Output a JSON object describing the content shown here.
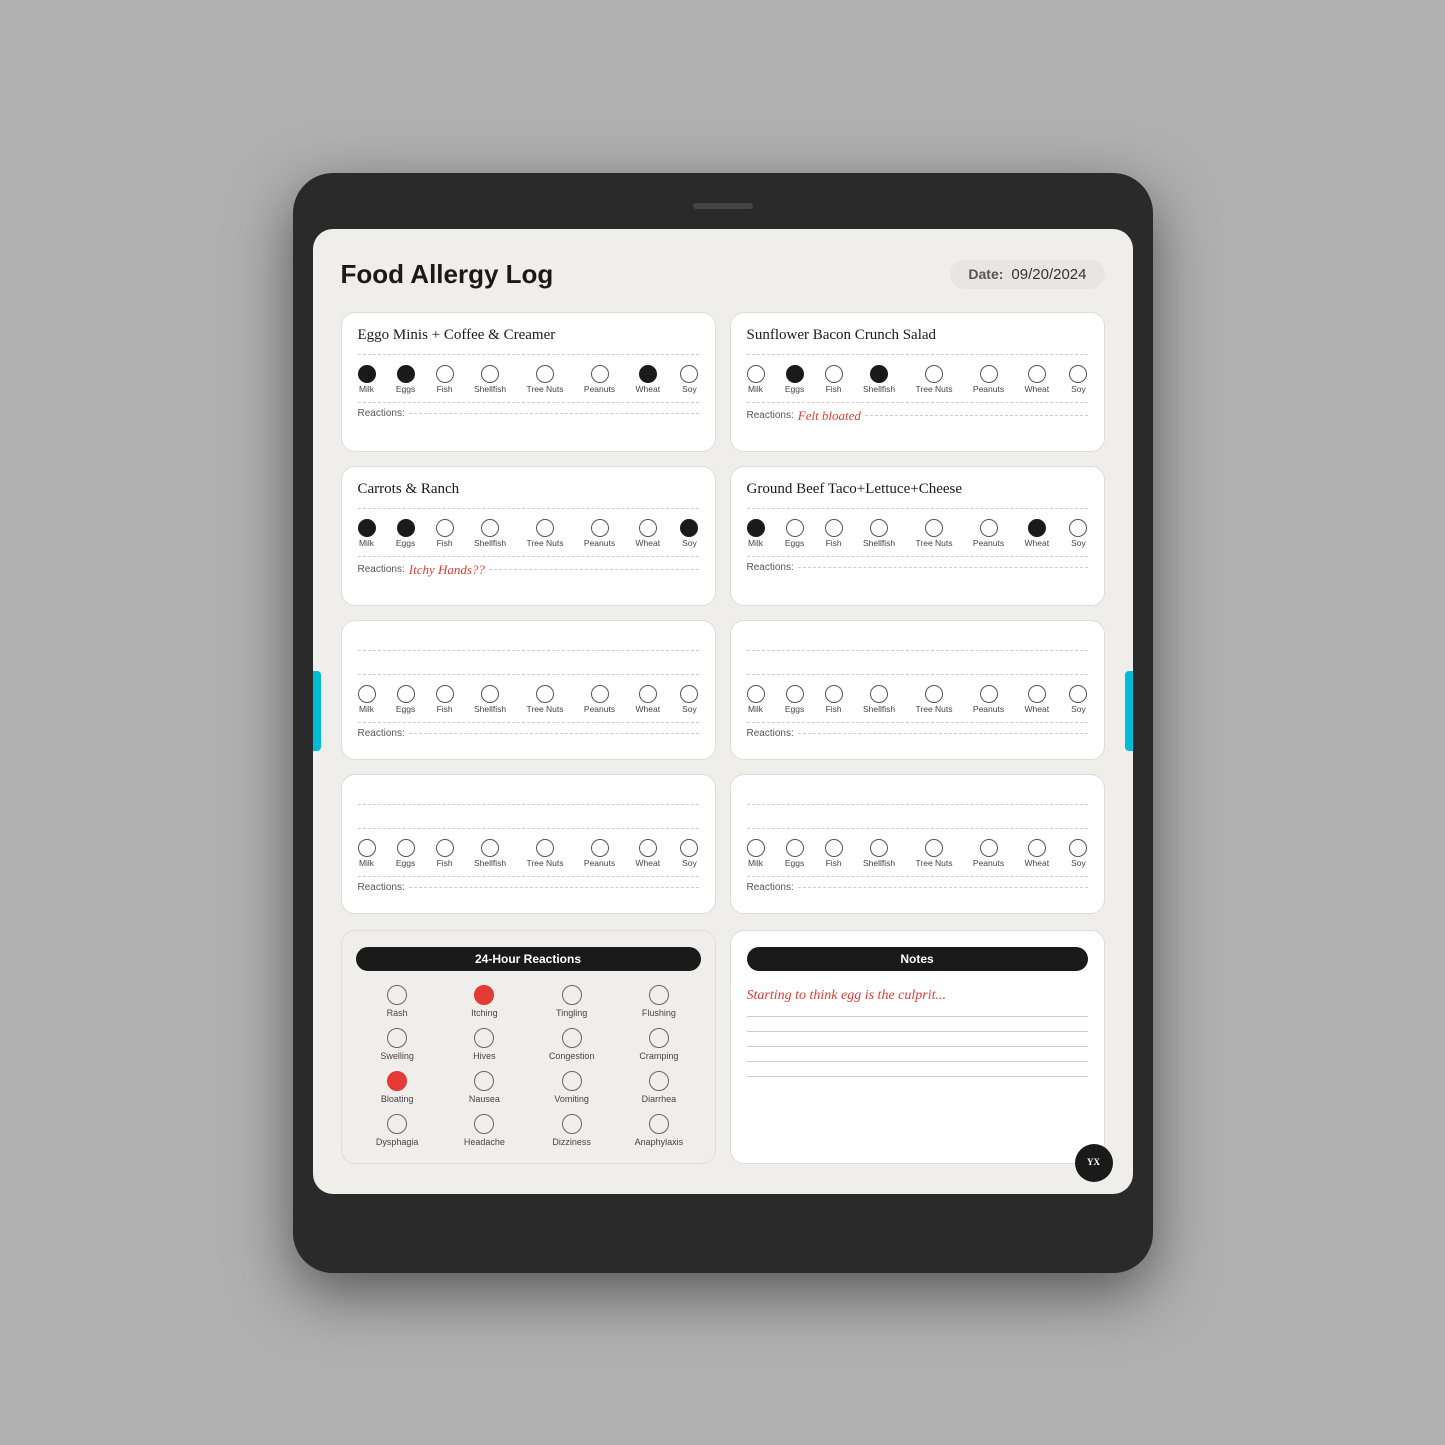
{
  "header": {
    "title": "Food Allergy Log",
    "date_label": "Date:",
    "date_value": "09/20/2024"
  },
  "allergens": [
    "Milk",
    "Eggs",
    "Fish",
    "Shellfish",
    "Tree Nuts",
    "Peanuts",
    "Wheat",
    "Soy"
  ],
  "meals": [
    {
      "id": 1,
      "name": "Eggo Minis + Coffee & Creamer",
      "filled": [
        true,
        true,
        false,
        false,
        false,
        false,
        true,
        false
      ],
      "reactions": "Reactions:",
      "reactions_text": "",
      "reactions_red": false
    },
    {
      "id": 2,
      "name": "Sunflower Bacon Crunch Salad",
      "filled": [
        false,
        true,
        false,
        true,
        false,
        false,
        false,
        false
      ],
      "reactions": "Reactions:",
      "reactions_text": "Felt bloated",
      "reactions_red": true
    },
    {
      "id": 3,
      "name": "Carrots & Ranch",
      "filled": [
        true,
        true,
        false,
        false,
        false,
        false,
        false,
        true
      ],
      "reactions": "Reactions:",
      "reactions_text": "Itchy Hands??",
      "reactions_red": true
    },
    {
      "id": 4,
      "name": "Ground Beef Taco+Lettuce+Cheese",
      "filled": [
        true,
        false,
        false,
        false,
        false,
        false,
        true,
        false
      ],
      "reactions": "Reactions:",
      "reactions_text": "",
      "reactions_red": false
    },
    {
      "id": 5,
      "name": "",
      "filled": [
        false,
        false,
        false,
        false,
        false,
        false,
        false,
        false
      ],
      "reactions": "Reactions:",
      "reactions_text": "",
      "reactions_red": false
    },
    {
      "id": 6,
      "name": "",
      "filled": [
        false,
        false,
        false,
        false,
        false,
        false,
        false,
        false
      ],
      "reactions": "Reactions:",
      "reactions_text": "",
      "reactions_red": false
    },
    {
      "id": 7,
      "name": "",
      "filled": [
        false,
        false,
        false,
        false,
        false,
        false,
        false,
        false
      ],
      "reactions": "Reactions:",
      "reactions_text": "",
      "reactions_red": false
    },
    {
      "id": 8,
      "name": "",
      "filled": [
        false,
        false,
        false,
        false,
        false,
        false,
        false,
        false
      ],
      "reactions": "Reactions:",
      "reactions_text": "",
      "reactions_red": false
    }
  ],
  "reactions_24h": {
    "title": "24-Hour Reactions",
    "items": [
      {
        "label": "Rash",
        "filled": false
      },
      {
        "label": "Itching",
        "filled": true
      },
      {
        "label": "Tingling",
        "filled": false
      },
      {
        "label": "Flushing",
        "filled": false
      },
      {
        "label": "Swelling",
        "filled": false
      },
      {
        "label": "Hives",
        "filled": false
      },
      {
        "label": "Congestion",
        "filled": false
      },
      {
        "label": "Cramping",
        "filled": false
      },
      {
        "label": "Bloating",
        "filled": true
      },
      {
        "label": "Nausea",
        "filled": false
      },
      {
        "label": "Vomiting",
        "filled": false
      },
      {
        "label": "Diarrhea",
        "filled": false
      },
      {
        "label": "Dysphagia",
        "filled": false
      },
      {
        "label": "Headache",
        "filled": false
      },
      {
        "label": "Dizziness",
        "filled": false
      },
      {
        "label": "Anaphylaxis",
        "filled": false
      }
    ]
  },
  "notes": {
    "title": "Notes",
    "text": "Starting to think egg is the culprit...",
    "lines": 5
  },
  "logo": "YX"
}
